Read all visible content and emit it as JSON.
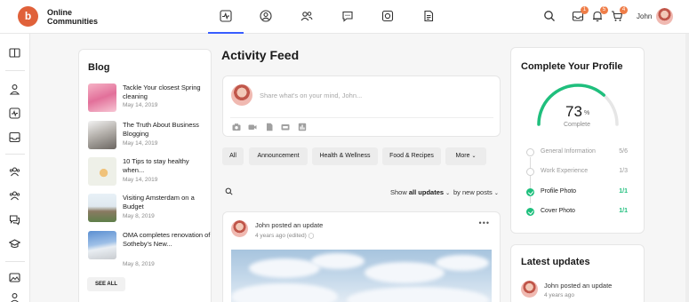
{
  "header": {
    "brand_line1": "Online",
    "brand_line2": "Communities",
    "logo_text": "b",
    "user_name": "John",
    "nav_icons": [
      "activity-icon",
      "profile-icon",
      "members-icon",
      "messages-icon",
      "media-icon",
      "documents-icon"
    ],
    "badges": {
      "messages": "1",
      "notifications": "5",
      "cart": "4"
    },
    "accent": "#385dff"
  },
  "sidebar": {
    "icons": [
      "book-icon",
      "user-icon",
      "activity-icon",
      "inbox-icon",
      "group-icon",
      "group-icon",
      "chat-icon",
      "graduation-cap-icon",
      "image-icon"
    ]
  },
  "blog": {
    "title": "Blog",
    "items": [
      {
        "title": "Tackle Your closest Spring cleaning",
        "date": "May 14, 2019"
      },
      {
        "title": "The Truth About Business Blogging",
        "date": "May 14, 2019"
      },
      {
        "title": "10 Tips to stay healthy when...",
        "date": "May 14, 2019"
      },
      {
        "title": "Visiting Amsterdam on a Budget",
        "date": "May 8, 2019"
      },
      {
        "title": "OMA completes renovation of Sotheby's New...",
        "date": "May 8, 2019"
      }
    ],
    "see_all": "SEE ALL"
  },
  "feed": {
    "title": "Activity Feed",
    "post_placeholder": "Share what's on your mind, John...",
    "tabs": [
      "All",
      "Announcement",
      "Health & Wellness",
      "Food & Recipes",
      "More"
    ],
    "show_prefix": "Show",
    "show_value": "all updates",
    "sort_value": "by new posts",
    "activity": {
      "author": "John",
      "action": "posted an update",
      "time": "4 years ago (edited)"
    }
  },
  "profile": {
    "title": "Complete Your Profile",
    "percent": "73",
    "percent_sign": "%",
    "percent_value": 73,
    "complete_label": "Complete",
    "ring_color": "#1fbf7d",
    "rows": [
      {
        "label": "General Information",
        "count": "5/6",
        "done": false
      },
      {
        "label": "Work Experience",
        "count": "1/3",
        "done": false
      },
      {
        "label": "Profile Photo",
        "count": "1/1",
        "done": true
      },
      {
        "label": "Cover Photo",
        "count": "1/1",
        "done": true
      }
    ]
  },
  "latest": {
    "title": "Latest updates",
    "author": "John",
    "action": "posted an update",
    "time": "4 years ago"
  }
}
